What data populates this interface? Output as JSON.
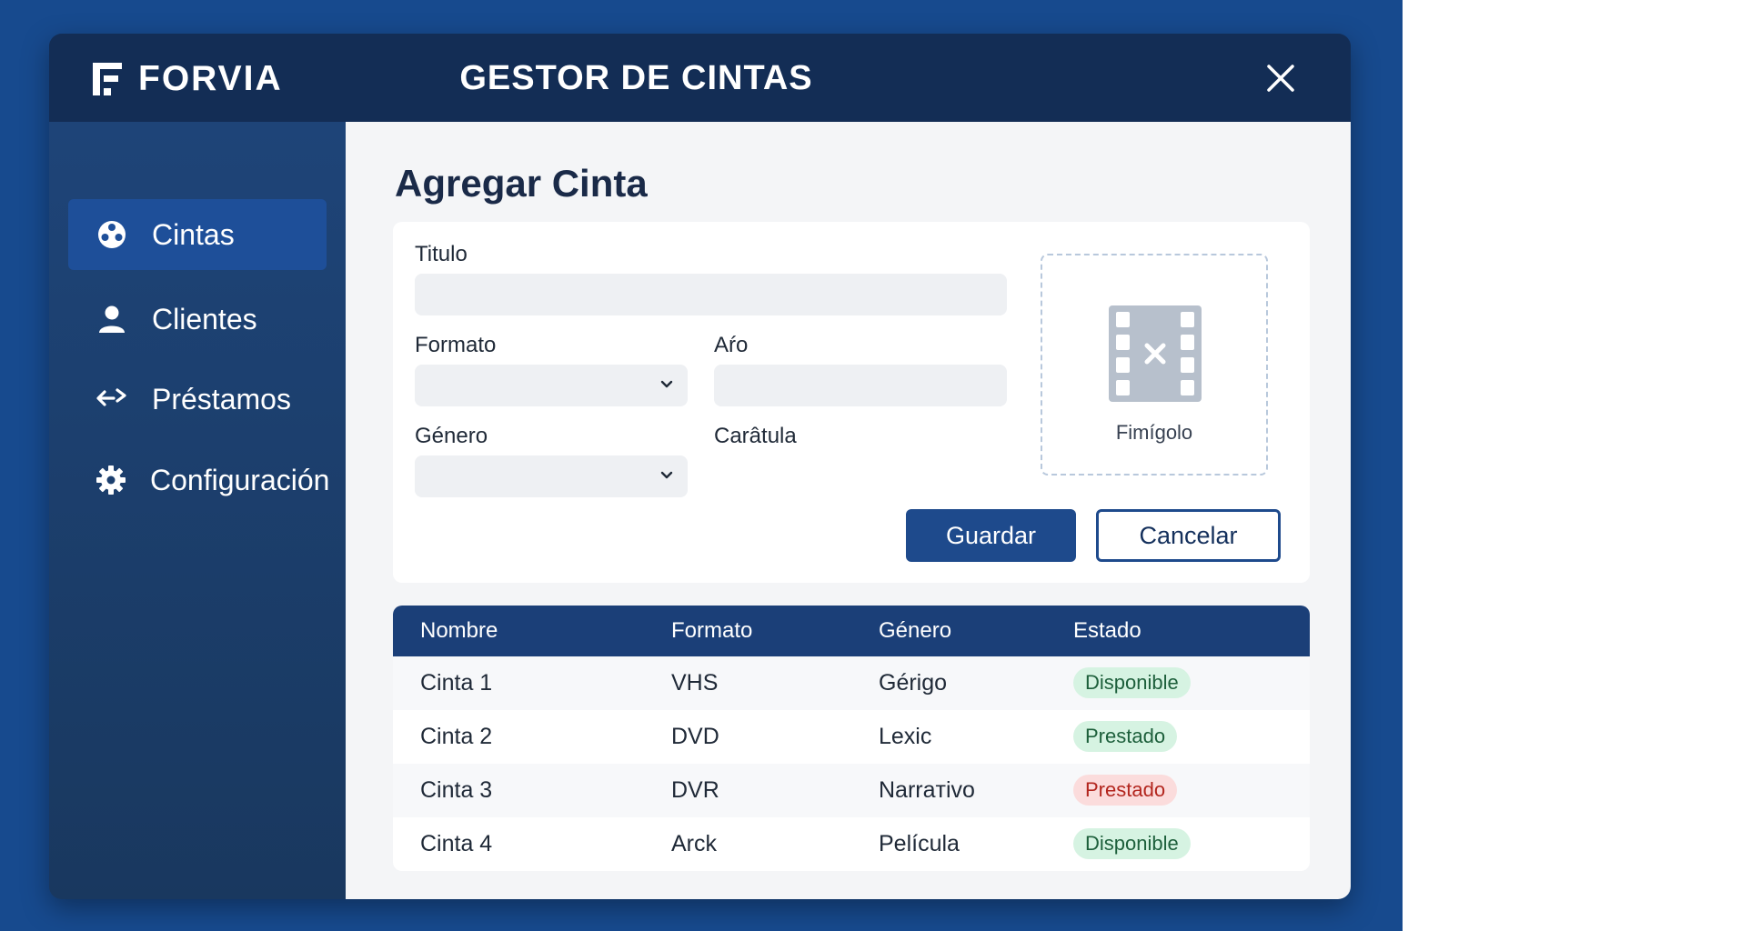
{
  "window": {
    "logo_text": "FORVIA",
    "title": "GESTOR DE CINTAS"
  },
  "sidebar": {
    "items": [
      {
        "label": "Cintas",
        "icon": "film-reel-icon",
        "active": true
      },
      {
        "label": "Clientes",
        "icon": "user-icon",
        "active": false
      },
      {
        "label": "Préstamos",
        "icon": "exchange-arrows-icon",
        "active": false
      },
      {
        "label": "Configuración",
        "icon": "gear-icon",
        "active": false
      }
    ]
  },
  "form": {
    "heading": "Agregar Cinta",
    "titulo_label": "Titulo",
    "formato_label": "Formato",
    "anio_label": "Aŕo",
    "genero_label": "Género",
    "caratula_label": "Carâtula",
    "upload_label": "Fimígolo",
    "upload_icon": "film-strip-x-icon",
    "save_label": "Guardar",
    "cancel_label": "Cancelar"
  },
  "table": {
    "headers": [
      "Nombre",
      "Formato",
      "Género",
      "Estado"
    ],
    "rows": [
      {
        "nombre": "Cinta 1",
        "formato": "VHS",
        "genero": "Gérigo",
        "estado": "Disponiblе",
        "estado_color": "green"
      },
      {
        "nombre": "Cinta 2",
        "formato": "DVD",
        "genero": "Lexic",
        "estado": "Prestado",
        "estado_color": "green"
      },
      {
        "nombre": "Cinta 3",
        "formato": "DVR",
        "genero": "Narraтivo",
        "estado": "Prestado",
        "estado_color": "red"
      },
      {
        "nombre": "Cinta 4",
        "formato": "Arck",
        "genero": "Película",
        "estado": "Disponible",
        "estado_color": "green"
      }
    ]
  },
  "colors": {
    "background": "#174a8e",
    "titlebar": "#132d55",
    "sidebar": "#1e4478",
    "accent": "#1e4a8c",
    "badge_green_bg": "#d6f3e2",
    "badge_red_bg": "#fbdcdc"
  }
}
